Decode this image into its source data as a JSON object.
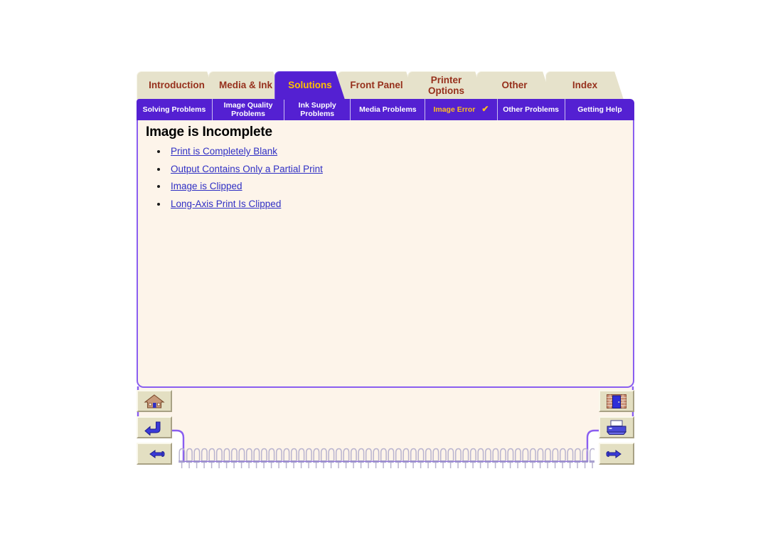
{
  "document": {
    "title": "Image is Incomplete"
  },
  "tabs": [
    {
      "label": "Introduction",
      "line2": "",
      "active": false,
      "name": "tab-introduction"
    },
    {
      "label": "Media & Ink",
      "line2": "",
      "active": false,
      "name": "tab-media-and-ink"
    },
    {
      "label": "Solutions",
      "line2": "",
      "active": true,
      "name": "tab-solutions"
    },
    {
      "label": "Front Panel",
      "line2": "",
      "active": false,
      "name": "tab-front-panel"
    },
    {
      "label": "Printer",
      "line2": "Options",
      "active": false,
      "name": "tab-printer-options"
    },
    {
      "label": "Other",
      "line2": "",
      "active": false,
      "name": "tab-other"
    },
    {
      "label": "Index",
      "line2": "",
      "active": false,
      "name": "tab-index"
    }
  ],
  "subtabs": [
    {
      "label": "Solving Problems",
      "line2": "",
      "active": false,
      "check": "",
      "name": "subtab-solving-problems"
    },
    {
      "label": "Image Quality",
      "line2": "Problems",
      "active": false,
      "check": "",
      "name": "subtab-image-quality-problems"
    },
    {
      "label": "Ink Supply",
      "line2": "Problems",
      "active": false,
      "check": "",
      "name": "subtab-ink-supply-problems"
    },
    {
      "label": "Media Problems",
      "line2": "",
      "active": false,
      "check": "",
      "name": "subtab-media-problems"
    },
    {
      "label": "Image Error",
      "line2": "",
      "active": true,
      "check": "✔",
      "name": "subtab-image-error"
    },
    {
      "label": "Other Problems",
      "line2": "",
      "active": false,
      "check": "",
      "name": "subtab-other-problems"
    },
    {
      "label": "Getting Help",
      "line2": "",
      "active": false,
      "check": "",
      "name": "subtab-getting-help"
    }
  ],
  "links": [
    {
      "label": "Print is Completely Blank",
      "name": "link-print-is-completely-blank"
    },
    {
      "label": "Output Contains Only a Partial Print",
      "name": "link-output-contains-only-a-partial-print"
    },
    {
      "label": "Image is Clipped",
      "name": "link-image-is-clipped"
    },
    {
      "label": "Long-Axis Print Is Clipped",
      "name": "link-long-axis-print-is-clipped"
    }
  ],
  "nav_left": [
    {
      "icon": "home-icon",
      "name": "home-button"
    },
    {
      "icon": "back-arrow-icon",
      "name": "back-button"
    },
    {
      "icon": "pointing-hand-left-icon",
      "name": "previous-page-button"
    }
  ],
  "nav_right": [
    {
      "icon": "exit-door-icon",
      "name": "exit-button"
    },
    {
      "icon": "printer-icon",
      "name": "print-button"
    },
    {
      "icon": "pointing-hand-right-icon",
      "name": "next-page-button"
    }
  ],
  "colors": {
    "accent_purple": "#5420d2",
    "tab_beige": "#e6e2cb",
    "tab_text": "#96301c",
    "active_tab_text": "#ffc000",
    "panel_bg": "#fdf4ea",
    "link_blue": "#2f2fc4",
    "panel_border": "#8a5ef0"
  }
}
